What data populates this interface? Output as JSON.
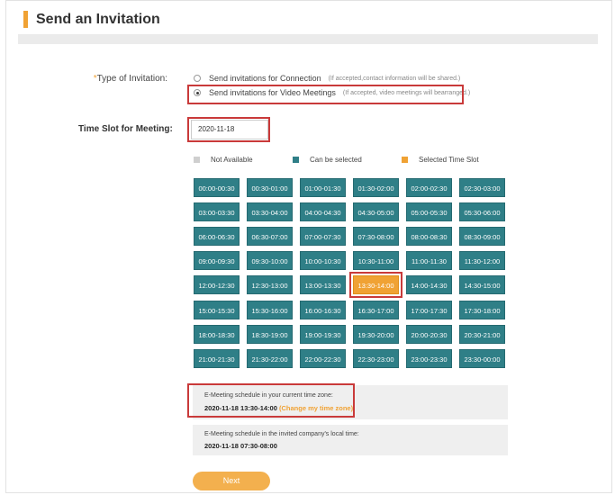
{
  "page": {
    "title": "Send an Invitation"
  },
  "invitation": {
    "label_mark": "*",
    "label": "Type of Invitation:",
    "options": [
      {
        "label": "Send invitations for Connection",
        "hint": "(If accepted,contact information will be shared.)",
        "selected": false
      },
      {
        "label": "Send invitations for Video Meetings",
        "hint": "(If accepted, video meetings will bearranged.)",
        "selected": true
      }
    ]
  },
  "time_slot": {
    "label": "Time Slot for Meeting:",
    "date_value": "2020-11-18"
  },
  "legend": [
    {
      "label": "Not Available",
      "color": "#cfcfcf"
    },
    {
      "label": "Can be selected",
      "color": "#2f7f87"
    },
    {
      "label": "Selected Time Slot",
      "color": "#f0a234"
    }
  ],
  "slots": [
    "00:00-00:30",
    "00:30-01:00",
    "01:00-01:30",
    "01:30-02:00",
    "02:00-02:30",
    "02:30-03:00",
    "03:00-03:30",
    "03:30-04:00",
    "04:00-04:30",
    "04:30-05:00",
    "05:00-05:30",
    "05:30-06:00",
    "06:00-06:30",
    "06:30-07:00",
    "07:00-07:30",
    "07:30-08:00",
    "08:00-08:30",
    "08:30-09:00",
    "09:00-09:30",
    "09:30-10:00",
    "10:00-10:30",
    "10:30-11:00",
    "11:00-11:30",
    "11:30-12:00",
    "12:00-12:30",
    "12:30-13:00",
    "13:00-13:30",
    "13:30-14:00",
    "14:00-14:30",
    "14:30-15:00",
    "15:00-15:30",
    "15:30-16:00",
    "16:00-16:30",
    "16:30-17:00",
    "17:00-17:30",
    "17:30-18:00",
    "18:00-18:30",
    "18:30-19:00",
    "19:00-19:30",
    "19:30-20:00",
    "20:00-20:30",
    "20:30-21:00",
    "21:00-21:30",
    "21:30-22:00",
    "22:00-22:30",
    "22:30-23:00",
    "23:00-23:30",
    "23:30-00:00"
  ],
  "selected_slot": "13:30-14:00",
  "schedule_local": {
    "label": "E-Meeting schedule in your current time zone:",
    "value": "2020-11-18 13:30-14:00",
    "change_link": "(Change my time zone)"
  },
  "schedule_invited": {
    "label": "E-Meeting schedule in the invited company's local time:",
    "value": "2020-11-18 07:30-08:00"
  },
  "next_button": "Next"
}
